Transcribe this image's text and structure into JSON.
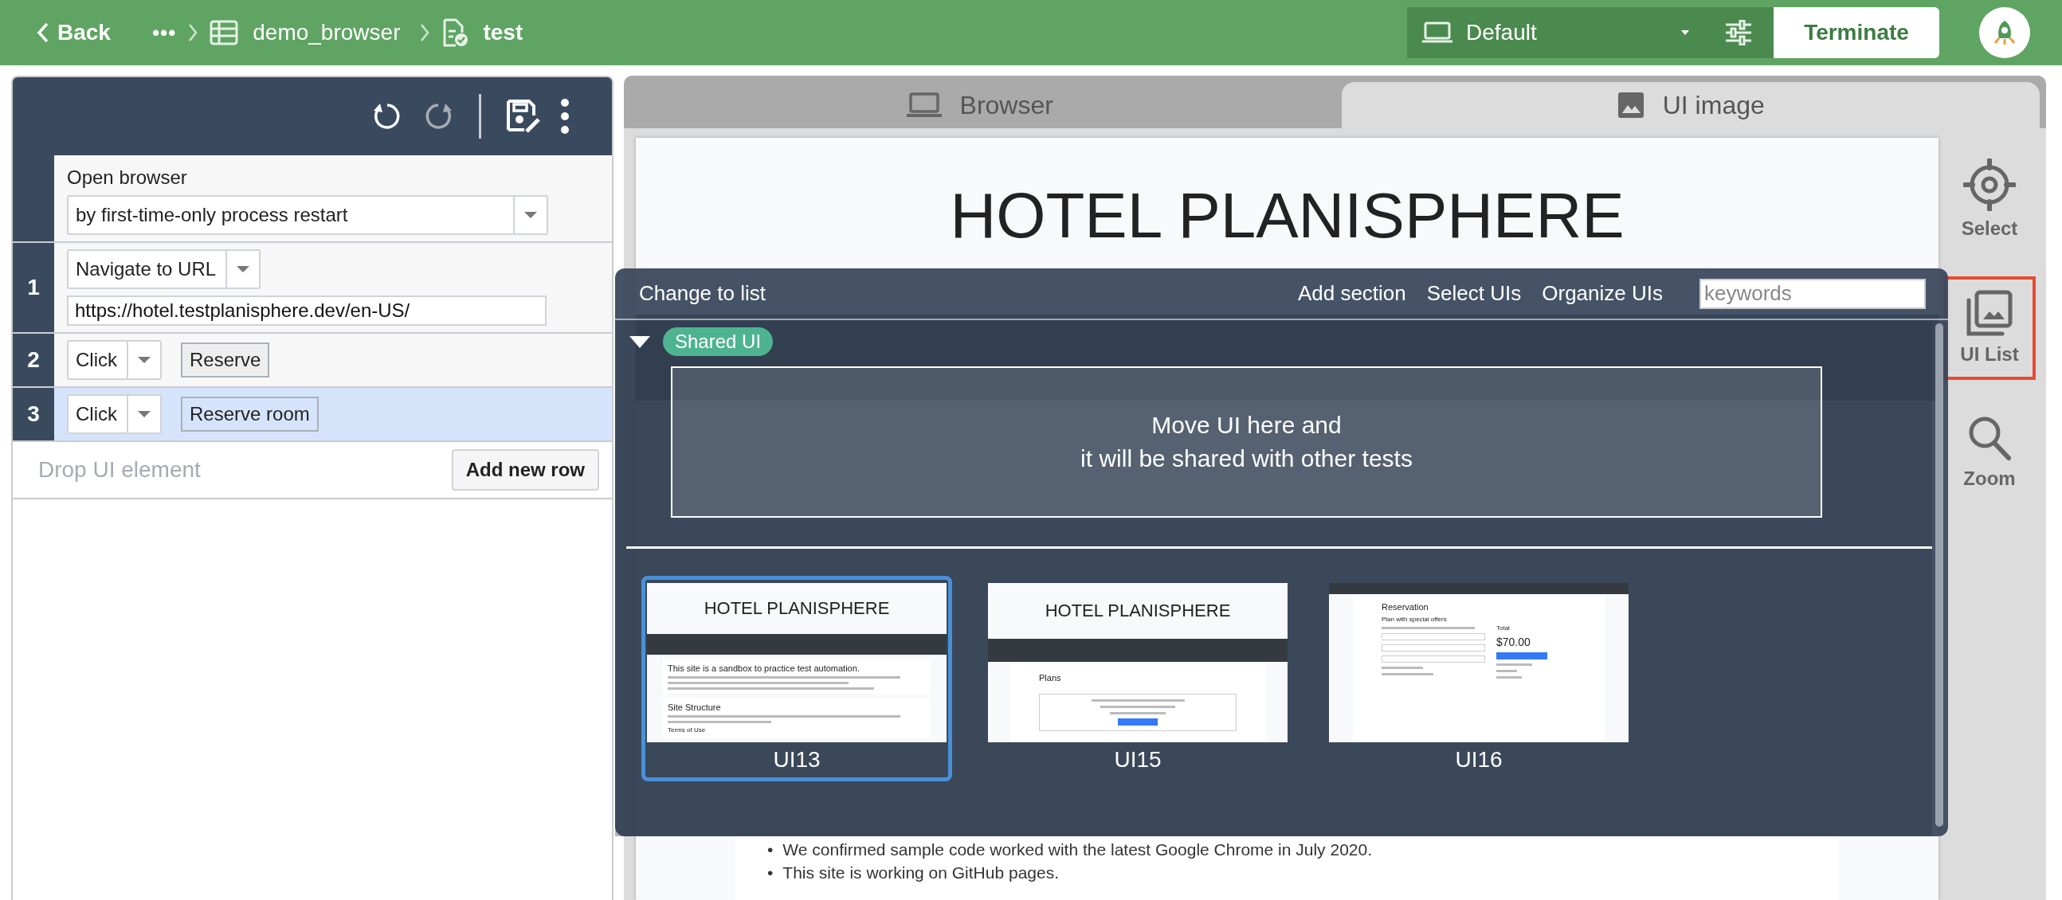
{
  "top_bar": {
    "back": "Back",
    "more": "•••",
    "breadcrumbs": [
      {
        "kind": "table",
        "label": "demo_browser"
      },
      {
        "kind": "test",
        "label": "test"
      }
    ],
    "environment": "Default",
    "terminate": "Terminate"
  },
  "editor": {
    "undo": {
      "disabled": false
    },
    "redo": {
      "disabled": true
    },
    "steps": [
      {
        "kind": "open",
        "title": "Open browser",
        "option": "by first-time-only process restart",
        "selected": false
      },
      {
        "kind": "navigate",
        "number": "1",
        "action": "Navigate to URL",
        "url": "https://hotel.testplanisphere.dev/en-US/",
        "selected": false
      },
      {
        "kind": "click",
        "number": "2",
        "action": "Click",
        "target": "Reserve",
        "selected": false
      },
      {
        "kind": "click",
        "number": "3",
        "action": "Click",
        "target": "Reserve room",
        "selected": true
      }
    ],
    "drop_placeholder": "Drop UI element",
    "add_row": "Add new row"
  },
  "view_tabs": [
    {
      "kind": "laptop",
      "label": "Browser",
      "selected": false
    },
    {
      "kind": "image",
      "label": "UI image",
      "selected": true
    }
  ],
  "tools": [
    {
      "kind": "select",
      "label": "Select",
      "selected": false
    },
    {
      "kind": "ui_list",
      "label": "UI List",
      "selected": true
    },
    {
      "kind": "zoom",
      "label": "Zoom",
      "selected": false
    }
  ],
  "page": {
    "title": "HOTEL PLANISPHERE",
    "bullets": [
      {
        "marker": "•",
        "text": "We confirmed sample code worked with the latest Google Chrome in July 2020."
      },
      {
        "marker": "•",
        "text": "This site is working on GitHub pages."
      }
    ]
  },
  "ui_list": {
    "change_view": "Change to list",
    "actions": [
      "Add section",
      "Select UIs",
      "Organize UIs"
    ],
    "search": {
      "placeholder": "keywords"
    },
    "section": {
      "name": "Shared UI",
      "expanded": true,
      "drop_hint": [
        "Move UI here and",
        "it will be shared with other tests"
      ]
    },
    "items": [
      {
        "kind": "home",
        "name": "UI13",
        "selected": true,
        "thumbnail": {
          "title": "HOTEL PLANISPHERE",
          "texts": [
            "This site is a sandbox to practice test automation.",
            "Site Structure",
            "Terms of Use"
          ]
        }
      },
      {
        "kind": "plans",
        "name": "UI15",
        "selected": false,
        "thumbnail": {
          "title": "HOTEL PLANISPHERE",
          "texts": [
            "Plans"
          ]
        }
      },
      {
        "kind": "reservation",
        "name": "UI16",
        "selected": false,
        "thumbnail": {
          "title": "Reservation",
          "texts": [
            "Plan with special offers",
            "Total",
            "$70.00"
          ]
        }
      }
    ]
  }
}
